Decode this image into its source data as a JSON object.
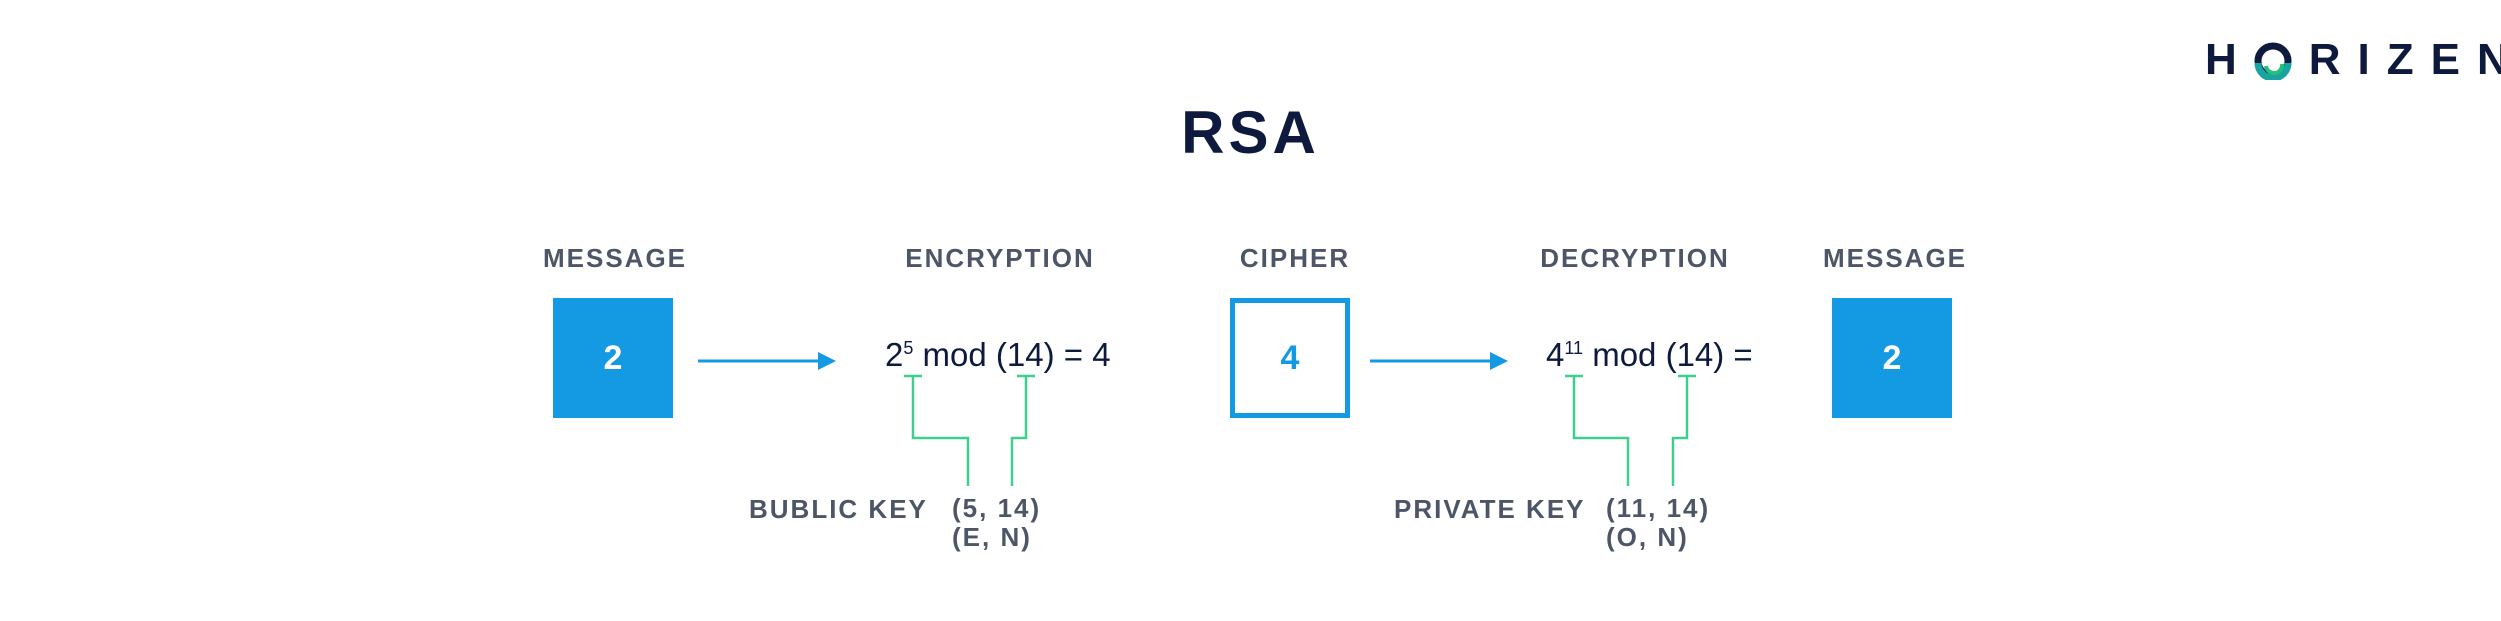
{
  "logo": {
    "text_before": "H",
    "text_after": "RIZEN",
    "trademark": "™"
  },
  "title": "RSA",
  "columns": {
    "message_left": "MESSAGE",
    "encryption": "ENCRYPTION",
    "cipher": "CIPHER",
    "decryption": "DECRYPTION",
    "message_right": "MESSAGE"
  },
  "boxes": {
    "message_left": "2",
    "cipher": "4",
    "message_right": "2"
  },
  "encryption_formula": {
    "base": "2",
    "exponent": "5",
    "rest": " mod (14) = 4"
  },
  "decryption_formula": {
    "base": "4",
    "exponent": "11",
    "rest": " mod (14) ="
  },
  "public_key": {
    "label": "BUBLIC KEY",
    "values": "(5, 14)",
    "symbols": "(E, N)"
  },
  "private_key": {
    "label": "PRIVATE KEY",
    "values": "(11, 14)",
    "symbols": "(O, N)"
  },
  "colors": {
    "accent_blue": "#1499e3",
    "connector_green": "#3ecf8e",
    "navy": "#0e1a3d",
    "label_gray": "#4d5667"
  }
}
